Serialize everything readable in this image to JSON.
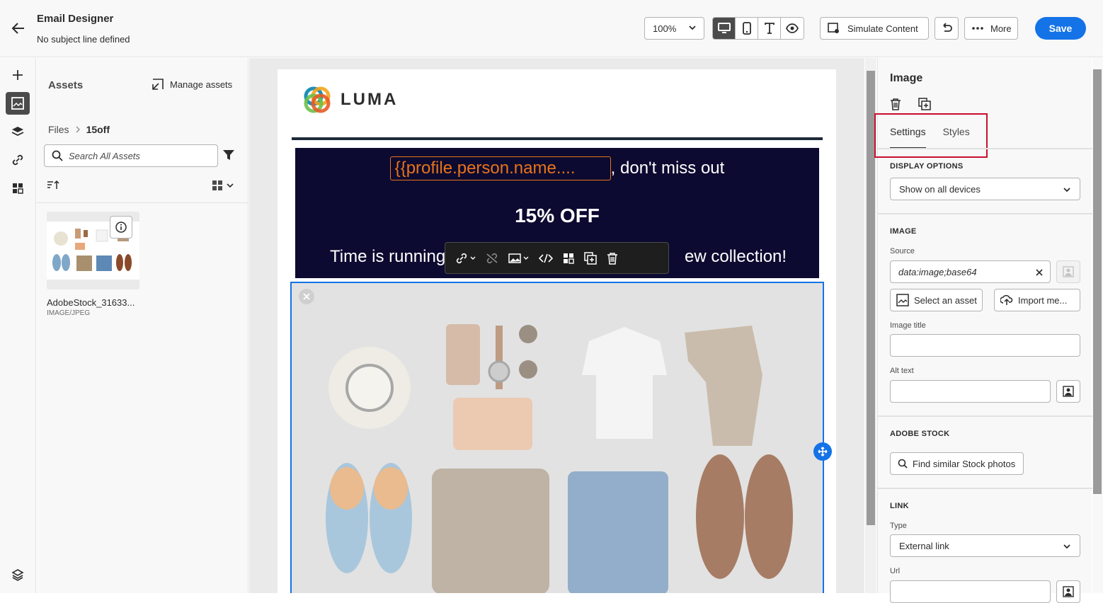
{
  "header": {
    "title": "Email Designer",
    "subtitle": "No subject line defined",
    "zoom": "100%",
    "simulate_label": "Simulate Content",
    "more_label": "More",
    "save_label": "Save"
  },
  "assets": {
    "title": "Assets",
    "manage_label": "Manage assets",
    "breadcrumb_root": "Files",
    "breadcrumb_current": "15off",
    "search_placeholder": "Search All Assets",
    "items": [
      {
        "name": "AdobeStock_31633...",
        "type": "IMAGE/JPEG"
      }
    ]
  },
  "email": {
    "logo_text": "LUMA",
    "token": "{{profile.person.name....",
    "line1_suffix": ", don't miss out",
    "line2": "15% OFF",
    "line3_left": "Time is running",
    "line3_right": "ew collection!"
  },
  "properties": {
    "title": "Image",
    "tabs": [
      "Settings",
      "Styles"
    ],
    "display_options_heading": "DISPLAY OPTIONS",
    "display_options_value": "Show on all devices",
    "image_heading": "IMAGE",
    "source_label": "Source",
    "source_value": "data:image;base64",
    "select_asset_label": "Select an asset",
    "import_label": "Import me...",
    "image_title_label": "Image title",
    "alt_text_label": "Alt text",
    "adobe_stock_heading": "ADOBE STOCK",
    "find_similar_label": "Find similar Stock photos",
    "link_heading": "LINK",
    "type_label": "Type",
    "type_value": "External link",
    "url_label": "Url"
  },
  "colors": {
    "accent": "#1473e6",
    "banner_bg": "#0c0a30",
    "token_orange": "#e8731a",
    "highlight_red": "#c8102e"
  }
}
